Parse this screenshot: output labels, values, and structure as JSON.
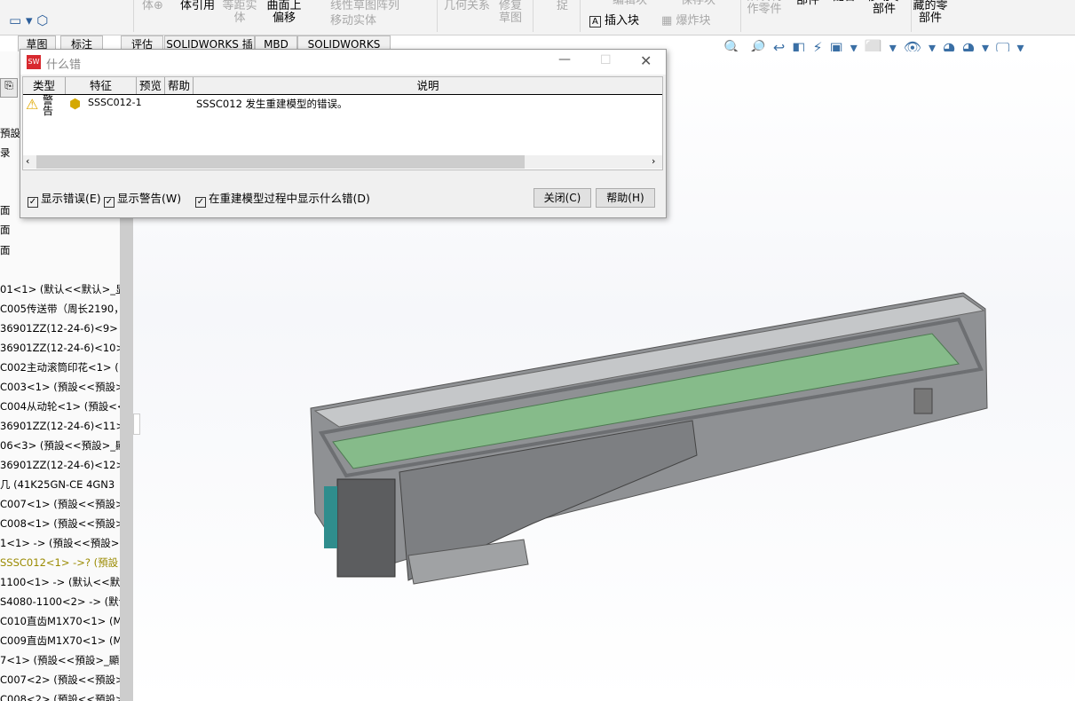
{
  "toolbar": {
    "items": [
      {
        "label": "体⊕",
        "disabled": true
      },
      {
        "label": "体引用",
        "disabled": false
      },
      {
        "label": "等距实体",
        "disabled": true
      },
      {
        "label": "曲面上偏移",
        "disabled": false
      },
      {
        "label": "线性草图阵列",
        "disabled": true
      },
      {
        "label": "移动实体",
        "disabled": true
      },
      {
        "label": "几何关系",
        "disabled": true
      },
      {
        "label": "修复草图",
        "disabled": true
      },
      {
        "label": "捉",
        "disabled": true
      },
      {
        "label": "编辑块",
        "disabled": true
      },
      {
        "label": "插入块",
        "disabled": false
      },
      {
        "label": "保存块",
        "disabled": true
      },
      {
        "label": "爆炸块",
        "disabled": true
      },
      {
        "label": "从块制作零件",
        "disabled": true
      },
      {
        "label": "部件",
        "disabled": false
      },
      {
        "label": "配合",
        "disabled": false
      },
      {
        "label": "移动零部件",
        "disabled": false
      },
      {
        "label": "显示隐藏的零部件",
        "disabled": false
      }
    ]
  },
  "tabs": [
    "草图",
    "标注",
    "评估",
    "SOLIDWORKS 插件",
    "MBD",
    "SOLIDWORKS CAM"
  ],
  "tree": {
    "top_items": [
      "預設",
      "录",
      "面",
      "面",
      "面"
    ],
    "items": [
      "01<1> (默认<<默认>_显",
      "C005传送带（周长2190，",
      "36901ZZ(12-24-6)<9> (",
      "36901ZZ(12-24-6)<10>",
      "C002主动滚筒印花<1> (",
      "C003<1> (預設<<預設>",
      "C004从动轮<1> (預設<<",
      "36901ZZ(12-24-6)<11>",
      "06<3> (預設<<預設>_顯",
      "36901ZZ(12-24-6)<12>",
      "几 (41K25GN-CE  4GN3",
      "C007<1> (預設<<預設>",
      "C008<1> (預設<<預設>",
      "1<1> -> (預設<<預設>",
      "SSSC012<1> ->? (預設",
      "1100<1> -> (默认<<默",
      "S4080-1100<2> -> (默认",
      "C010直齿M1X70<1> (M",
      "C009直齿M1X70<1> (M",
      "7<1> (預設<<預設>_顯",
      "C007<2> (預設<<預設>",
      "C008<2> (預設<<預設>"
    ],
    "warning_index": 14,
    "warning_color": "#9a8a00"
  },
  "dialog": {
    "title": "什么错",
    "columns": [
      "类型",
      "特征",
      "预览",
      "帮助",
      "说明"
    ],
    "rows": [
      {
        "type": "警告",
        "feature": "SSSC012-1",
        "preview": "",
        "help": "",
        "description": "SSSC012 发生重建模型的错误。"
      }
    ],
    "checkboxes": [
      {
        "label": "显示错误(E)",
        "checked": true
      },
      {
        "label": "显示警告(W)",
        "checked": true
      },
      {
        "label": "在重建模型过程中显示什么错(D)",
        "checked": true
      }
    ],
    "buttons": {
      "close": "关闭(C)",
      "help": "帮助(H)"
    }
  },
  "colors": {
    "belt": "#86bb8a",
    "frame": "#a9a9a9",
    "accent": "#d8292f"
  }
}
